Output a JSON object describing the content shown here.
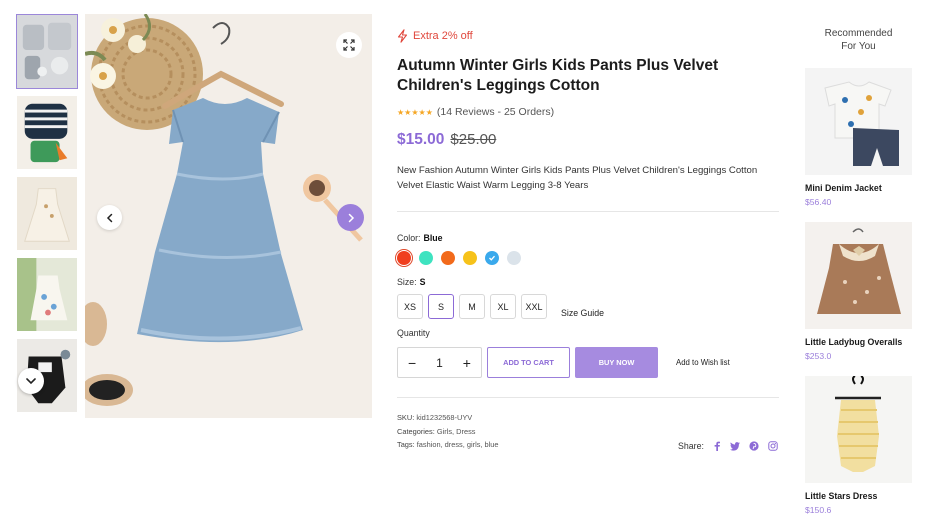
{
  "product": {
    "promo_label": "Extra 2% off",
    "title": "Autumn Winter Girls Kids Pants Plus Velvet Children's Leggings Cotton",
    "rating_stars": 5,
    "reviews_text": "(14 Reviews - 25 Orders)",
    "price": "$15.00",
    "old_price": "$25.00",
    "description": "New Fashion Autumn Winter Girls Kids Pants Plus Velvet Children's Leggings Cotton Velvet Elastic Waist Warm Legging 3-8 Years",
    "color_label": "Color:",
    "color_value": "Blue",
    "colors": [
      "#f03e1e",
      "#3ee3c0",
      "#f26a1b",
      "#f6c21a",
      "#3aa9ec",
      "#dbe3ea"
    ],
    "size_label": "Size:",
    "size_value": "S",
    "sizes": [
      "XS",
      "S",
      "M",
      "XL",
      "XXL"
    ],
    "size_guide": "Size Guide",
    "quantity_label": "Quantity",
    "quantity": "1",
    "add_to_cart": "ADD TO CART",
    "buy_now": "BUY NOW",
    "wishlist": "Add to Wish list",
    "sku_label": "SKU:",
    "sku": "kid1232568-UYV",
    "categories_label": "Categories:",
    "categories": "Girls, Dress",
    "tags_label": "Tags:",
    "tags": "fashion, dress, girls, blue",
    "share_label": "Share:"
  },
  "gallery": {
    "thumbnails": [
      "baby-outfit-set",
      "striped-romper",
      "cream-dress",
      "floral-dress",
      "black-romper"
    ]
  },
  "recommended": {
    "heading_line1": "Recommended",
    "heading_line2": "For You",
    "items": [
      {
        "name": "Mini Denim Jacket",
        "price": "$56.40"
      },
      {
        "name": "Little Ladybug Overalls",
        "price": "$253.0"
      },
      {
        "name": "Little Stars Dress",
        "price": "$150.6"
      }
    ]
  },
  "colors": {
    "accent": "#9b7fdb",
    "promo": "#e0473c"
  }
}
